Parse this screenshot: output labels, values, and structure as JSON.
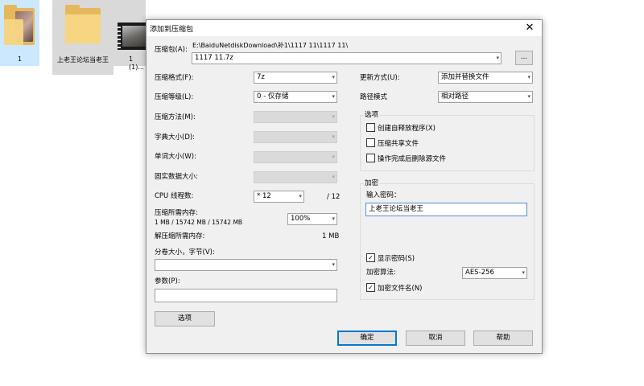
{
  "desktop": {
    "items": [
      {
        "label": "1"
      },
      {
        "label": "上老王论坛当老王"
      },
      {
        "label": "1 (1)..."
      }
    ]
  },
  "dialog": {
    "title": "添加到压缩包",
    "close_glyph": "✕",
    "archive_label": "压缩包(A):",
    "archive_path": "E:\\BaiduNetdiskDownload\\补1\\1117 11\\1117 11\\",
    "archive_name": "1117 11.7z",
    "browse_label": "...",
    "left": {
      "format_label": "压缩格式(F):",
      "format_value": "7z",
      "level_label": "压缩等级(L):",
      "level_value": "0 - 仅存储",
      "method_label": "压缩方法(M):",
      "dict_label": "字典大小(D):",
      "word_label": "单词大小(W):",
      "solid_label": "固实数据大小:",
      "cpu_label": "CPU 线程数:",
      "cpu_value": "* 12",
      "cpu_max": "/ 12",
      "mem_comp_label": "压缩所需内存:",
      "mem_comp_detail": "1 MB / 15742 MB / 15742 MB",
      "mem_comp_value": "100%",
      "mem_decomp_label": "解压缩所需内存:",
      "mem_decomp_value": "1 MB",
      "split_label": "分卷大小，字节(V):",
      "params_label": "参数(P):",
      "options_button": "选项"
    },
    "right": {
      "update_label": "更新方式(U):",
      "update_value": "添加并替换文件",
      "path_label": "路径模式",
      "path_value": "相对路径",
      "options_group": "选项",
      "opt_sfx": "创建自释放程序(X)",
      "opt_shared": "压缩共享文件",
      "opt_delete": "操作完成后删除源文件",
      "enc_group": "加密",
      "password_label": "输入密码：",
      "password_value": "上老王论坛当老王",
      "show_password": "显示密码(S)",
      "enc_method_label": "加密算法:",
      "enc_method_value": "AES-256",
      "enc_names": "加密文件名(N)",
      "check_glyph": "✓"
    },
    "buttons": {
      "ok": "确定",
      "cancel": "取消",
      "help": "帮助"
    }
  }
}
